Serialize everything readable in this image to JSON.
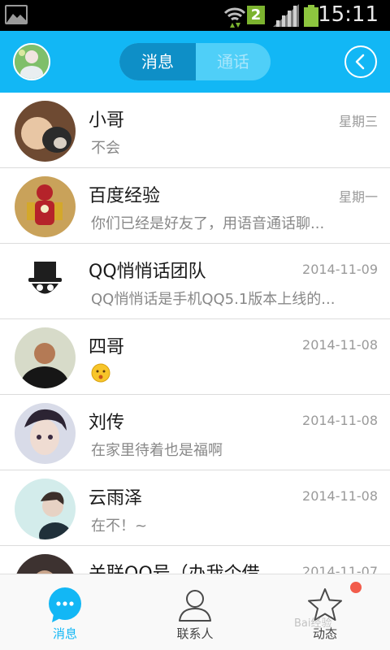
{
  "status_bar": {
    "time": "15:11",
    "sim_badge": "2",
    "icons": [
      "picture-icon",
      "wifi-icon",
      "signal-icon",
      "battery-icon"
    ]
  },
  "header": {
    "tabs": [
      {
        "label": "消息",
        "active": true
      },
      {
        "label": "通话",
        "active": false
      }
    ],
    "accent_color": "#12b7f5"
  },
  "conversations": [
    {
      "name": "小哥",
      "date": "星期三",
      "preview": "不会"
    },
    {
      "name": "百度经验",
      "date": "星期一",
      "preview": "你们已经是好友了，用语音通话聊..."
    },
    {
      "name": "QQ悄悄话团队",
      "date": "2014-11-09",
      "preview": "QQ悄悄话是手机QQ5.1版本上线的..."
    },
    {
      "name": "四哥",
      "date": "2014-11-08",
      "preview": ""
    },
    {
      "name": "刘传",
      "date": "2014-11-08",
      "preview": "在家里待着也是福啊"
    },
    {
      "name": "云雨泽",
      "date": "2014-11-08",
      "preview": "在不！~"
    },
    {
      "name": "关联QQ号（办我个借",
      "date": "2014-11-07",
      "preview": ""
    }
  ],
  "tabbar": {
    "items": [
      {
        "label": "消息",
        "active": true
      },
      {
        "label": "联系人",
        "active": false
      },
      {
        "label": "动态",
        "active": false
      }
    ]
  },
  "watermark": "Bai经验"
}
